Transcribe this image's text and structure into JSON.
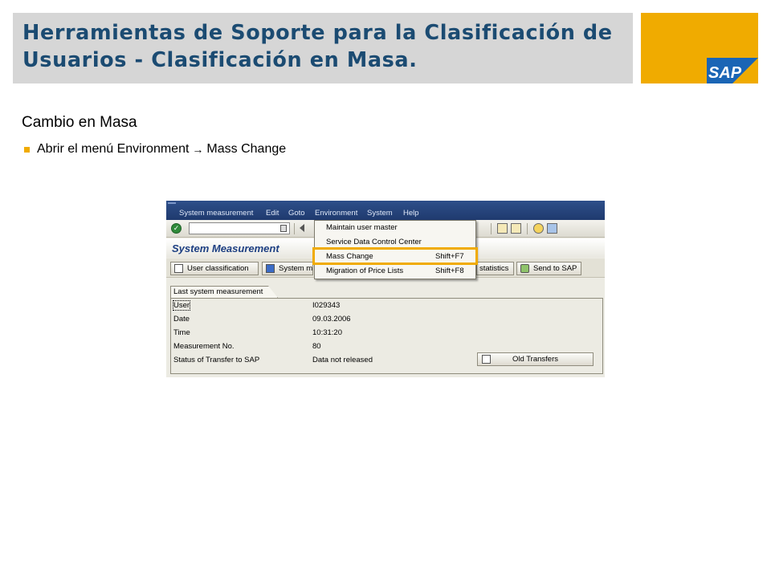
{
  "slide": {
    "title": "Herramientas de Soporte para la Clasificación de Usuarios - Clasificación en Masa.",
    "subtitle": "Cambio en Masa",
    "bullet_before": "Abrir el menú Environment",
    "bullet_arrow": "→",
    "bullet_after": "Mass Change",
    "brand": "SAP",
    "colors": {
      "title": "#1b4b72",
      "header_bar": "#d6d6d6",
      "accent": "#f0ab00"
    }
  },
  "gui": {
    "menubar": [
      "System measurement",
      "Edit",
      "Goto",
      "Environment",
      "System",
      "Help"
    ],
    "screen_title": "System Measurement",
    "app_buttons": {
      "user_classification": "User classification",
      "system_measurement_partial": "System me",
      "statistics_partial": "statistics",
      "send_to_sap": "Send to SAP"
    },
    "environment_menu": [
      {
        "label": "Maintain user master",
        "shortcut": ""
      },
      {
        "label": "Service Data Control Center",
        "shortcut": ""
      },
      {
        "label": "Mass Change",
        "shortcut": "Shift+F7"
      },
      {
        "label": "Migration of Price Lists",
        "shortcut": "Shift+F8"
      }
    ],
    "group_title": "Last system measurement",
    "fields": [
      {
        "label": "User",
        "value": "I029343"
      },
      {
        "label": "Date",
        "value": "09.03.2006"
      },
      {
        "label": "Time",
        "value": "10:31:20"
      },
      {
        "label": "Measurement No.",
        "value": "80"
      },
      {
        "label": "Status of Transfer to SAP",
        "value": "Data not released"
      }
    ],
    "old_transfers": "Old Transfers"
  }
}
